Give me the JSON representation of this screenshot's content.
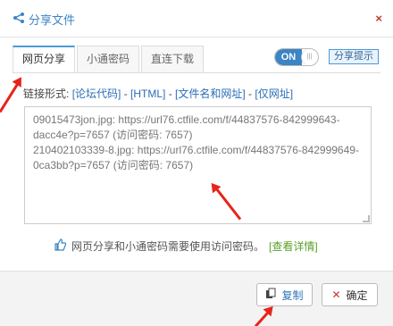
{
  "window": {
    "title": "分享文件",
    "close_label": "×"
  },
  "tabs": [
    "网页分享",
    "小通密码",
    "直连下载"
  ],
  "toggle": {
    "label": "ON"
  },
  "hint_button": "分享提示",
  "link_formats": {
    "prefix": "链接形式:",
    "items": [
      "[论坛代码]",
      "[HTML]",
      "[文件名和网址]",
      "[仅网址]"
    ],
    "separator": " - "
  },
  "share_text": [
    "09015473jon.jpg: https://url76.ctfile.com/f/44837576-842999643-dacc4e?p=7657 (访问密码: 7657)",
    "210402103339-8.jpg: https://url76.ctfile.com/f/44837576-842999649-0ca3bb?p=7657 (访问密码: 7657)"
  ],
  "note": {
    "text": "网页分享和小通密码需要使用访问密码。",
    "link": "[查看详情]"
  },
  "buttons": {
    "copy": "复制",
    "ok": "确定"
  },
  "colors": {
    "accent": "#3b84c5",
    "annotation": "#e8231a",
    "link_green": "#5aa028"
  }
}
